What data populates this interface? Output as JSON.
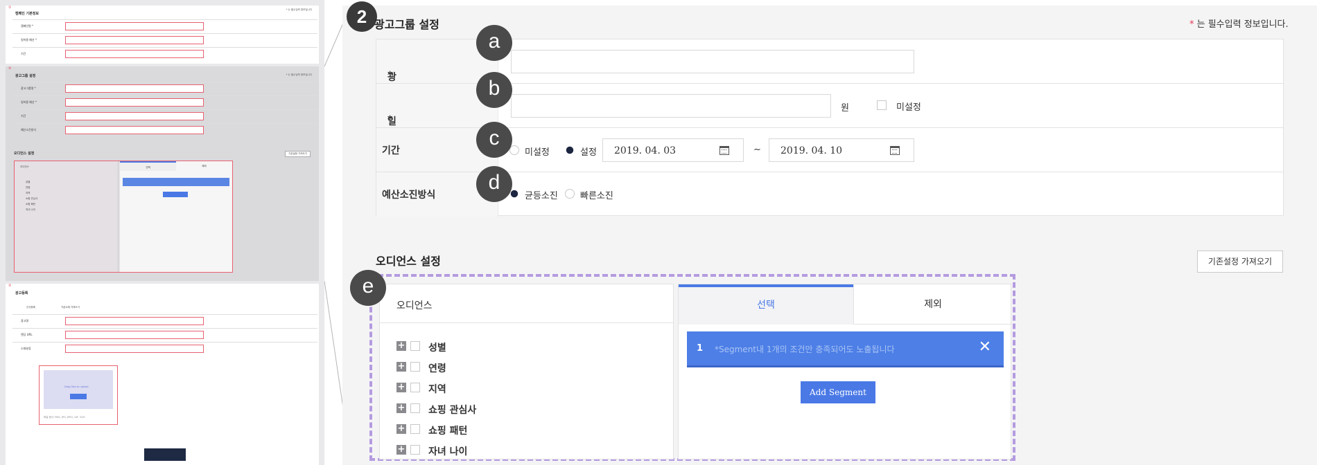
{
  "colors": {
    "accent": "#4a79e6",
    "required": "#e53950",
    "dashed_border": "#b49be0",
    "badge": "#4a4a4a"
  },
  "thumbnail": {
    "campaign_title": "캠페인 기본정보",
    "required_note": "* 는 필수입력 정보입니다",
    "rows1": [
      "캠페인명 *",
      "일허용 예산 *",
      "기간"
    ],
    "adgroup_title": "광고그룹 설정",
    "rows2": [
      "광고그룹명 *",
      "일허용 예산 *",
      "기간",
      "예산소진방식"
    ],
    "audience_title": "오디언스 설정",
    "audience_btn": "기존설정 가져오기",
    "audience_head": "오디언스",
    "tab_select": "선택",
    "tab_exclude": "제외",
    "aud_items": [
      "성별",
      "연령",
      "지역",
      "쇼핑 관심사",
      "쇼핑 패턴",
      "자녀 나이"
    ],
    "add_segment": "Add Segment",
    "creative_title": "광고등록",
    "creative_tabs": [
      "신규등록",
      "기존소재 가져오기"
    ],
    "rows3": [
      "광고명",
      "랜딩 URL",
      "소재분류"
    ],
    "upload_text": "Drag files to upload",
    "upload_btn": "파일선택",
    "upload_hint": "파일 형식: PNG, JPG, JPEG, GIF, SVG",
    "done_btn": "완료"
  },
  "step": "2",
  "section": {
    "title": "광고그룹 설정",
    "required_star": "*",
    "required_note": " 는 필수입력 정보입니다."
  },
  "badges": {
    "a": "a",
    "b": "b",
    "c": "c",
    "d": "d",
    "e": "e"
  },
  "form": {
    "name_label": "광고그룹명",
    "budget_label": "일허용 예산",
    "budget_unit": "원",
    "budget_unset": "미설정",
    "period_label": "기간",
    "period_unset": "미설정",
    "period_set": "설정",
    "start_date": "2019. 04. 03",
    "tilde": "~",
    "end_date": "2019. 04. 10",
    "spend_label": "예산소진방식",
    "spend_even": "균등소진",
    "spend_fast": "빠른소진",
    "star": "*"
  },
  "audience": {
    "title": "오디언스 설정",
    "prev_button": "기존설정 가져오기",
    "panel_head": "오디언스",
    "items": [
      "성별",
      "연령",
      "지역",
      "쇼핑 관심사",
      "쇼핑 패턴",
      "자녀 나이"
    ],
    "tab_select": "선택",
    "tab_exclude": "제외",
    "segment_no": "1",
    "segment_text": "*Segment내 1개의 조건만 충족되어도 노출됩니다",
    "add_segment": "Add Segment"
  }
}
